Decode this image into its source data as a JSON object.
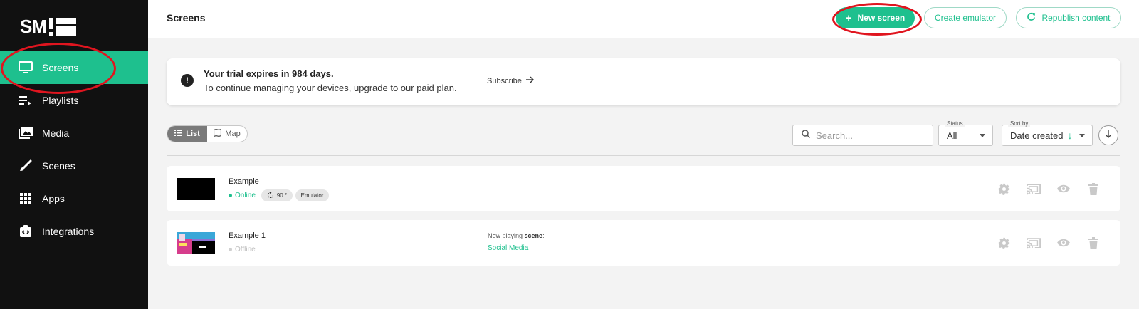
{
  "sidebar": {
    "logo_text": "SM",
    "items": [
      {
        "label": "Screens",
        "icon": "monitor-icon",
        "active": true
      },
      {
        "label": "Playlists",
        "icon": "playlist-icon",
        "active": false
      },
      {
        "label": "Media",
        "icon": "media-icon",
        "active": false
      },
      {
        "label": "Scenes",
        "icon": "brush-icon",
        "active": false
      },
      {
        "label": "Apps",
        "icon": "grid-icon",
        "active": false
      },
      {
        "label": "Integrations",
        "icon": "integrations-icon",
        "active": false
      }
    ]
  },
  "header": {
    "title": "Screens",
    "new_screen_label": "New screen",
    "create_emulator_label": "Create emulator",
    "republish_label": "Republish content"
  },
  "banner": {
    "title": "Your trial expires in 984 days.",
    "text": "To continue managing your devices, upgrade to our paid plan.",
    "subscribe_label": "Subscribe"
  },
  "toolbar": {
    "list_label": "List",
    "map_label": "Map",
    "search_placeholder": "Search...",
    "status_label": "Status",
    "status_value": "All",
    "sort_label": "Sort by",
    "sort_value": "Date created"
  },
  "screens": [
    {
      "name": "Example",
      "status": "Online",
      "rotation": "90 °",
      "tag": "Emulator"
    },
    {
      "name": "Example 1",
      "status": "Offline",
      "now_playing_prefix": "Now playing ",
      "now_playing_type": "scene",
      "now_playing_suffix": ":",
      "scene_name": "Social Media"
    }
  ],
  "colors": {
    "accent": "#1ec08e",
    "sidebar_bg": "#111111",
    "annotation": "#e0151f"
  }
}
